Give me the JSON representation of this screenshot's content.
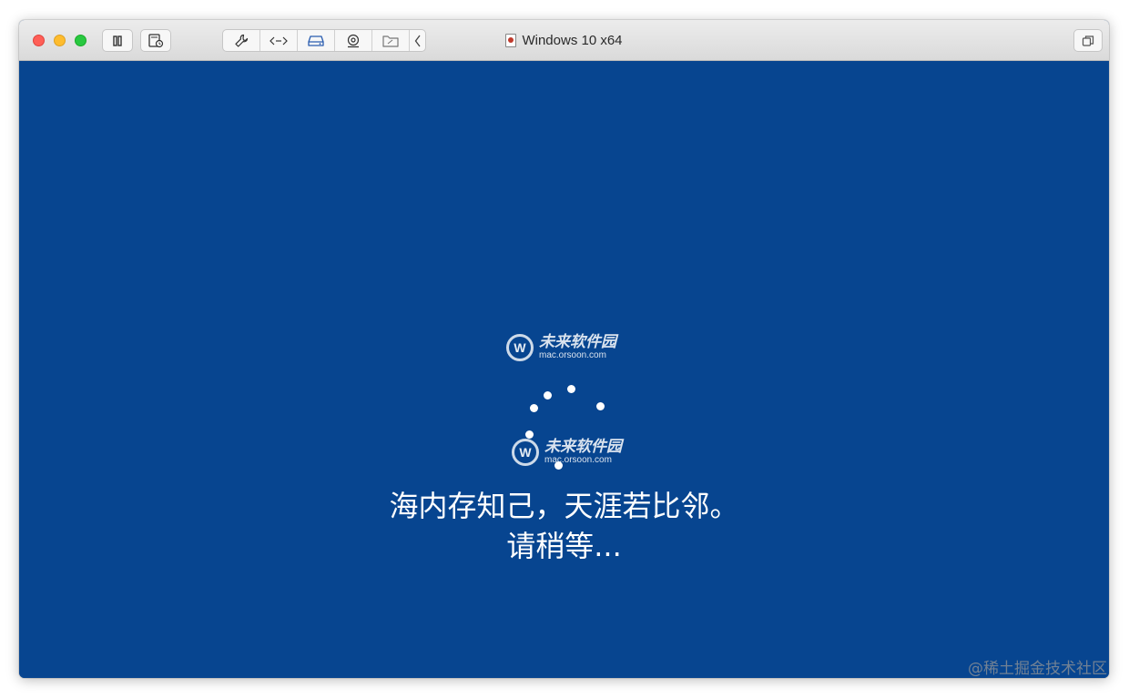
{
  "window": {
    "title": "Windows 10 x64"
  },
  "toolbar": {
    "buttons": [
      {
        "name": "pause",
        "icon": "pause-icon"
      },
      {
        "name": "snapshot",
        "icon": "snapshot-icon"
      },
      {
        "name": "settings",
        "icon": "wrench-icon"
      },
      {
        "name": "network",
        "icon": "code-arrows-icon"
      },
      {
        "name": "disk",
        "icon": "hard-disk-icon"
      },
      {
        "name": "camera",
        "icon": "webcam-icon"
      },
      {
        "name": "shared-folder",
        "icon": "folder-icon"
      },
      {
        "name": "collapse",
        "icon": "chevron-left-icon"
      },
      {
        "name": "restore",
        "icon": "copy-windows-icon"
      }
    ]
  },
  "screen": {
    "background": "#074590",
    "watermark": {
      "name": "未来软件园",
      "url": "mac.orsoon.com"
    },
    "message_line1": "海内存知己，天涯若比邻。",
    "message_line2": "请稍等..."
  },
  "page": {
    "corner_watermark": "@稀土掘金技术社区"
  }
}
